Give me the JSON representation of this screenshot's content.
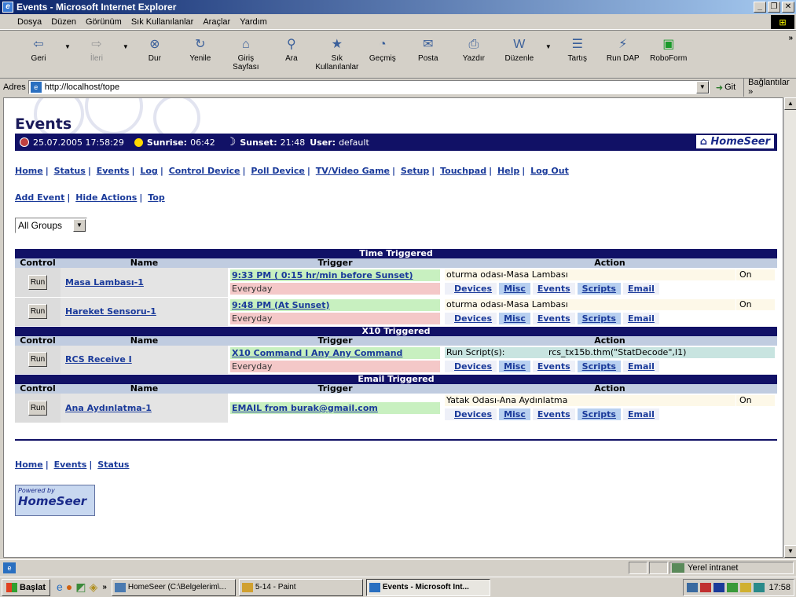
{
  "window": {
    "title": "Events - Microsoft Internet Explorer"
  },
  "menu": [
    "Dosya",
    "Düzen",
    "Görünüm",
    "Sık Kullanılanlar",
    "Araçlar",
    "Yardım"
  ],
  "toolbar": {
    "back": "Geri",
    "forward": "İleri",
    "stop": "Dur",
    "refresh": "Yenile",
    "home": "Giriş Sayfası",
    "search": "Ara",
    "favorites": "Sık Kullanılanlar",
    "history": "Geçmiş",
    "mail": "Posta",
    "print": "Yazdır",
    "edit": "Düzenle",
    "discuss": "Tartış",
    "rundap": "Run DAP",
    "roboform": "RoboForm"
  },
  "address": {
    "label": "Adres",
    "url": "http://localhost/tope",
    "go": "Git",
    "links": "Bağlantılar"
  },
  "page": {
    "title": "Events",
    "datetime": "25.07.2005 17:58:29",
    "sunrise_label": "Sunrise:",
    "sunrise": "06:42",
    "sunset_label": "Sunset:",
    "sunset": "21:48",
    "user_label": "User:",
    "user": "default",
    "logo": "HomeSeer",
    "nav": [
      "Home",
      "Status",
      "Events",
      "Log",
      "Control Device",
      "Poll Device",
      "TV/Video Game",
      "Setup",
      "Touchpad",
      "Help",
      "Log Out"
    ],
    "actions": [
      "Add Event",
      "Hide Actions",
      "Top"
    ],
    "group_select": "All Groups",
    "columns": {
      "control": "Control",
      "name": "Name",
      "trigger": "Trigger",
      "action": "Action"
    },
    "run_label": "Run",
    "action_buttons": [
      "Devices",
      "Misc",
      "Events",
      "Scripts",
      "Email"
    ],
    "sections": [
      {
        "title": "Time Triggered",
        "rows": [
          {
            "name": "Masa Lambası-1",
            "trigger": "9:33 PM ( 0:15 hr/min before Sunset)",
            "trigger_sub": "Everyday",
            "action": "oturma odası-Masa Lambası",
            "state": "On"
          },
          {
            "name": "Hareket Sensoru-1",
            "trigger": "9:48 PM (At Sunset)",
            "trigger_sub": "Everyday",
            "action": "oturma odası-Masa Lambası",
            "state": "On"
          }
        ]
      },
      {
        "title": "X10 Triggered",
        "rows": [
          {
            "name": "RCS Receive I",
            "trigger": "X10 Command I Any Any Command",
            "trigger_sub": "Everyday",
            "action_label": "Run Script(s):",
            "action": "rcs_tx15b.thm(\"StatDecode\",I1)"
          }
        ]
      },
      {
        "title": "Email Triggered",
        "rows": [
          {
            "name": "Ana Aydınlatma-1",
            "trigger": "EMAIL from burak@gmail.com",
            "action": "Yatak Odası-Ana Aydınlatma",
            "state": "On"
          }
        ]
      }
    ],
    "footer_links": [
      "Home",
      "Events",
      "Status"
    ],
    "powered_by": "Powered by",
    "powered_logo": "HomeSeer"
  },
  "statusbar": {
    "zone": "Yerel intranet"
  },
  "taskbar": {
    "start": "Başlat",
    "tasks": [
      "HomeSeer (C:\\Belgelerim\\...",
      "5-14 - Paint",
      "Events - Microsoft Int..."
    ],
    "clock": "17:58"
  }
}
